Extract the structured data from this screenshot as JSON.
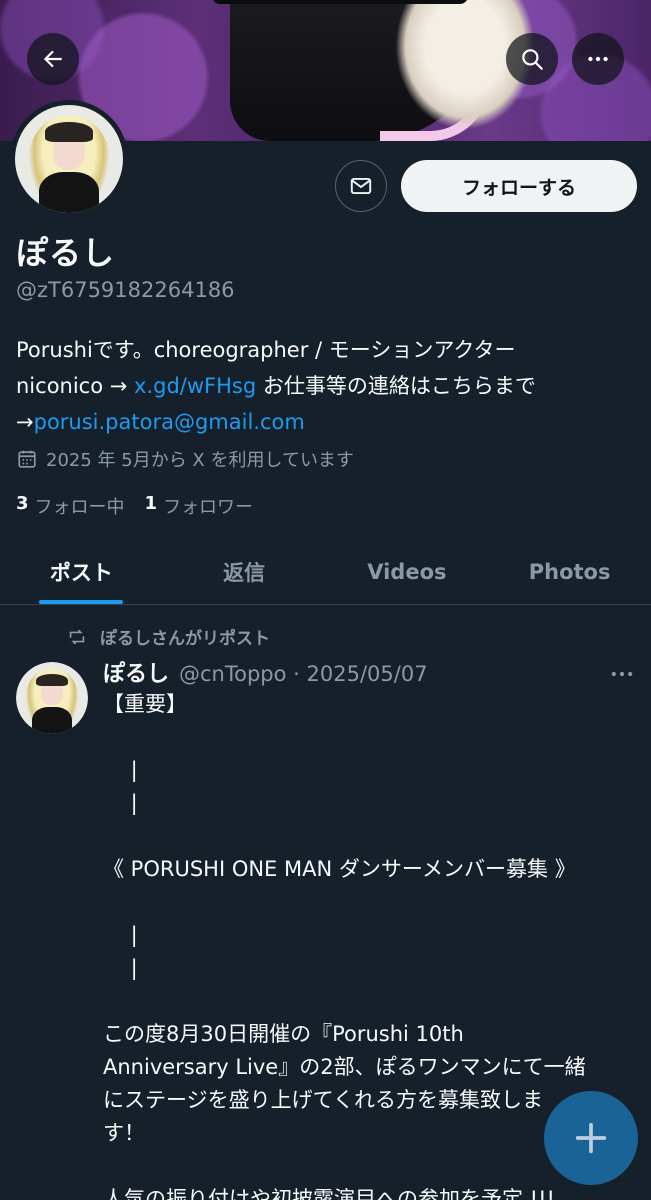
{
  "profile": {
    "display_name": "ぽるし",
    "handle": "@zT6759182264186",
    "bio_line1": "Porushiです。choreographer / モーションアクター",
    "bio_line2_pre": "niconico → ",
    "bio_link1": "x.gd/wFHsg",
    "bio_line2_post": " お仕事等の連絡はこちらまで",
    "bio_line3_pre": "→",
    "bio_link2": "porusi.patora@gmail.com",
    "joined": "2025 年 5月から X を利用しています",
    "following_count": "3",
    "following_label": "フォロー中",
    "followers_count": "1",
    "followers_label": "フォロワー",
    "follow_button": "フォローする"
  },
  "tabs": [
    {
      "label": "ポスト",
      "active": true
    },
    {
      "label": "返信",
      "active": false
    },
    {
      "label": "Videos",
      "active": false
    },
    {
      "label": "Photos",
      "active": false
    }
  ],
  "post": {
    "repost_label": "ぽるしさんがリポスト",
    "author_name": "ぽるし",
    "author_meta": "@cnToppo · 2025/05/07",
    "lines": [
      "【重要】",
      "",
      "　 |",
      "　 |",
      "",
      "《 PORUSHI ONE MAN ダンサーメンバー募集 》",
      "",
      "　 |",
      "　 |",
      "",
      "この度8月30日開催の『Porushi 10th",
      "Anniversary Live』の2部、ぽるワンマンにて一緒",
      "にステージを盛り上げてくれる方を募集致しま",
      "す！",
      "",
      "人気の振り付けや初披露演目への参加を予定 !!!"
    ]
  },
  "icons": {
    "back": "arrow-left-icon",
    "search": "search-icon",
    "more": "more-dots-icon",
    "message": "envelope-icon",
    "calendar": "calendar-icon",
    "repost": "repost-icon",
    "compose": "plus-icon"
  },
  "colors": {
    "background": "#15202b",
    "accent": "#1d9bf0",
    "secondary_text": "#8b98a5"
  }
}
